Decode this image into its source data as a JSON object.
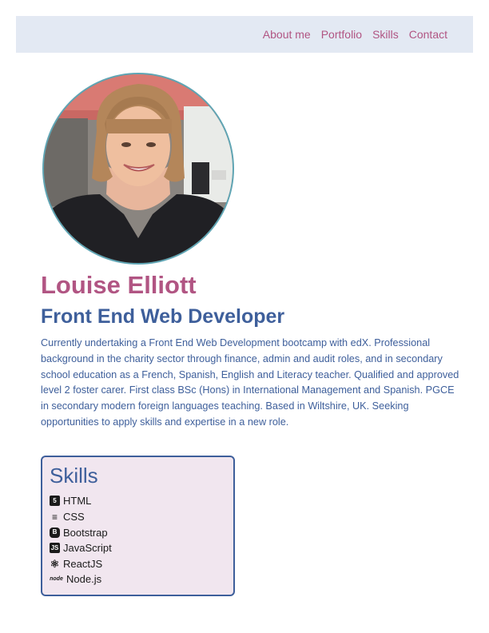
{
  "nav": {
    "items": [
      {
        "label": "About me"
      },
      {
        "label": "Portfolio"
      },
      {
        "label": "Skills"
      },
      {
        "label": "Contact"
      }
    ]
  },
  "profile": {
    "name": "Louise Elliott",
    "role": "Front End Web Developer",
    "bio": "Currently undertaking a Front End Web Development bootcamp with edX. Professional background in the charity sector through finance, admin and audit roles, and in secondary school education as a French, Spanish, English and Literacy teacher. Qualified and approved level 2 foster carer. First class BSc (Hons) in International Management and Spanish. PGCE in secondary modern foreign languages teaching. Based in Wiltshire, UK. Seeking opportunities to apply skills and expertise in a new role."
  },
  "skills": {
    "title": "Skills",
    "items": [
      {
        "label": "HTML",
        "icon": "html5-icon",
        "glyph": "5"
      },
      {
        "label": "CSS",
        "icon": "css3-icon",
        "glyph": "≡"
      },
      {
        "label": "Bootstrap",
        "icon": "bootstrap-icon",
        "glyph": "B"
      },
      {
        "label": "JavaScript",
        "icon": "javascript-icon",
        "glyph": "JS"
      },
      {
        "label": "ReactJS",
        "icon": "react-icon",
        "glyph": "⚛"
      },
      {
        "label": "Node.js",
        "icon": "nodejs-icon",
        "glyph": "node"
      }
    ]
  },
  "colors": {
    "nav_background": "#e3e9f3",
    "accent_pink": "#b15583",
    "accent_blue": "#3e5f9b",
    "card_background": "#f1e6ef",
    "avatar_border": "#5fa5b4"
  }
}
